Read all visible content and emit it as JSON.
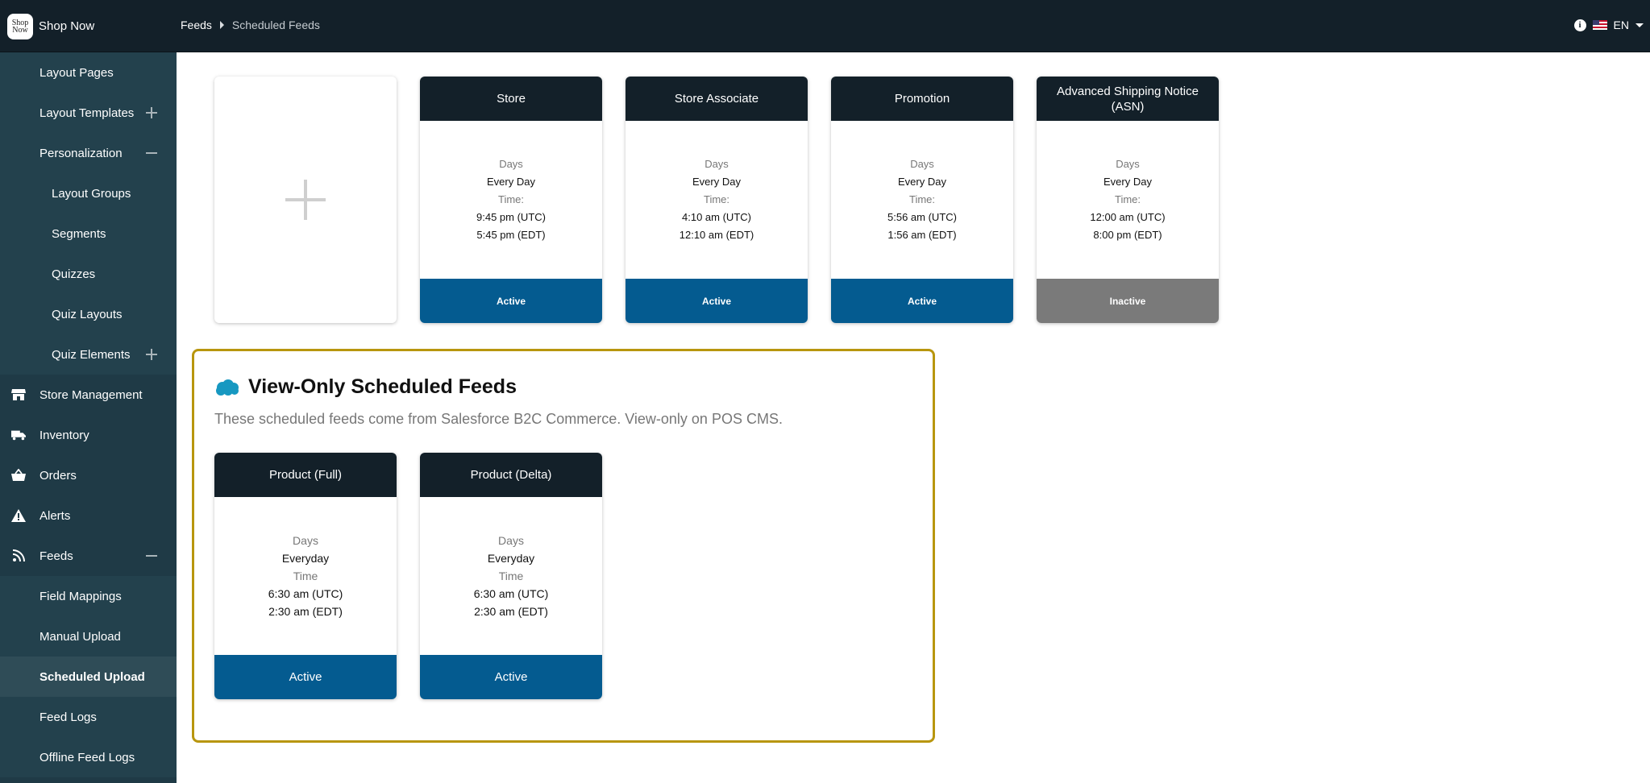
{
  "app": {
    "name": "Shop Now",
    "logo_text": "Shop Now"
  },
  "header": {
    "breadcrumb": {
      "parent": "Feeds",
      "current": "Scheduled Feeds"
    },
    "language": "EN",
    "icons": {
      "info": "info-icon",
      "flag": "us-flag-icon",
      "caret": "chevron-down-icon"
    }
  },
  "sidebar": {
    "items": [
      {
        "label": "Layout Pages",
        "level": 1
      },
      {
        "label": "Layout Templates",
        "level": 1,
        "toggle": "plus"
      },
      {
        "label": "Personalization",
        "level": 1,
        "toggle": "minus"
      },
      {
        "label": "Layout Groups",
        "level": 2
      },
      {
        "label": "Segments",
        "level": 2
      },
      {
        "label": "Quizzes",
        "level": 2
      },
      {
        "label": "Quiz Layouts",
        "level": 2
      },
      {
        "label": "Quiz Elements",
        "level": 2,
        "toggle": "plus"
      },
      {
        "label": "Store Management",
        "level": 0,
        "icon": "storefront-icon"
      },
      {
        "label": "Inventory",
        "level": 0,
        "icon": "truck-icon"
      },
      {
        "label": "Orders",
        "level": 0,
        "icon": "basket-icon"
      },
      {
        "label": "Alerts",
        "level": 0,
        "icon": "warning-icon"
      },
      {
        "label": "Feeds",
        "level": 0,
        "icon": "rss-icon",
        "toggle": "minus"
      },
      {
        "label": "Field Mappings",
        "level": 1
      },
      {
        "label": "Manual Upload",
        "level": 1
      },
      {
        "label": "Scheduled Upload",
        "level": 1,
        "active": true
      },
      {
        "label": "Feed Logs",
        "level": 1
      },
      {
        "label": "Offline Feed Logs",
        "level": 1
      }
    ]
  },
  "scheduled_feeds": [
    {
      "title": "Store",
      "days_label": "Days",
      "days": "Every Day",
      "time_label": "Time:",
      "time_utc": "9:45 pm (UTC)",
      "time_local": "5:45 pm (EDT)",
      "status": "Active"
    },
    {
      "title": "Store Associate",
      "days_label": "Days",
      "days": "Every Day",
      "time_label": "Time:",
      "time_utc": "4:10 am (UTC)",
      "time_local": "12:10 am (EDT)",
      "status": "Active"
    },
    {
      "title": "Promotion",
      "days_label": "Days",
      "days": "Every Day",
      "time_label": "Time:",
      "time_utc": "5:56 am (UTC)",
      "time_local": "1:56 am (EDT)",
      "status": "Active"
    },
    {
      "title": "Advanced Shipping Notice (ASN)",
      "days_label": "Days",
      "days": "Every Day",
      "time_label": "Time:",
      "time_utc": "12:00 am (UTC)",
      "time_local": "8:00 pm (EDT)",
      "status": "Inactive"
    }
  ],
  "view_only": {
    "title": "View-Only Scheduled Feeds",
    "description": "These scheduled feeds come from Salesforce B2C Commerce. View-only on POS CMS.",
    "icon": "salesforce-cloud-icon",
    "feeds": [
      {
        "title": "Product (Full)",
        "days_label": "Days",
        "days": "Everyday",
        "time_label": "Time",
        "time_utc": "6:30 am (UTC)",
        "time_local": "2:30 am (EDT)",
        "status": "Active"
      },
      {
        "title": "Product (Delta)",
        "days_label": "Days",
        "days": "Everyday",
        "time_label": "Time",
        "time_utc": "6:30 am (UTC)",
        "time_local": "2:30 am (EDT)",
        "status": "Active"
      }
    ]
  },
  "colors": {
    "topbar": "#132029",
    "sidebar": "#1f3a46",
    "active_status": "#045b90",
    "inactive_status": "#7a7a7a",
    "view_only_border": "#b8960e",
    "salesforce_cloud": "#1798c1"
  }
}
